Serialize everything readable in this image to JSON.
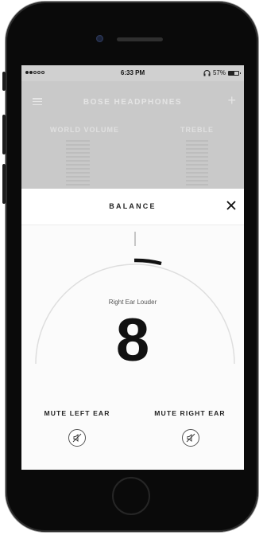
{
  "status_bar": {
    "time": "6:33 PM",
    "battery_percent": "57%",
    "battery_level": 0.57,
    "signal_bars": 2
  },
  "background_app": {
    "title": "BOSE HEADPHONES",
    "left_label": "WORLD VOLUME",
    "right_label": "TREBLE"
  },
  "balance": {
    "title": "BALANCE",
    "caption": "Right Ear Louder",
    "value": "8",
    "mute_left_label": "MUTE LEFT EAR",
    "mute_right_label": "MUTE RIGHT EAR"
  }
}
